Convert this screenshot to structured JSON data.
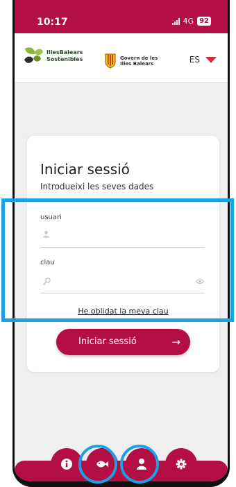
{
  "status_bar": {
    "time": "10:17",
    "network": "4G",
    "battery": "92"
  },
  "header": {
    "brand_line1": "IllesBalears",
    "brand_line2": "Sostenibles",
    "gov_line1": "Govern de les",
    "gov_line2": "Illes Balears",
    "language": "ES"
  },
  "login": {
    "title": "Iniciar sessió",
    "subtitle": "Introdueixi les seves dades",
    "user_label": "usuari",
    "user_value": "",
    "password_label": "clau",
    "password_value": "",
    "forgot_link": "He oblidat la meva clau",
    "submit_label": "Iniciar sessió",
    "submit_icon": "arrow-right-icon"
  },
  "bottom_nav": {
    "items": [
      "info-icon",
      "fish-icon",
      "user-icon",
      "gear-icon"
    ],
    "highlighted": [
      "fish-icon",
      "user-icon"
    ]
  },
  "colors": {
    "brand": "#b30f44",
    "background": "#efefef",
    "annotation": "#1aa0e6",
    "language_marker": "#d32f3f"
  }
}
